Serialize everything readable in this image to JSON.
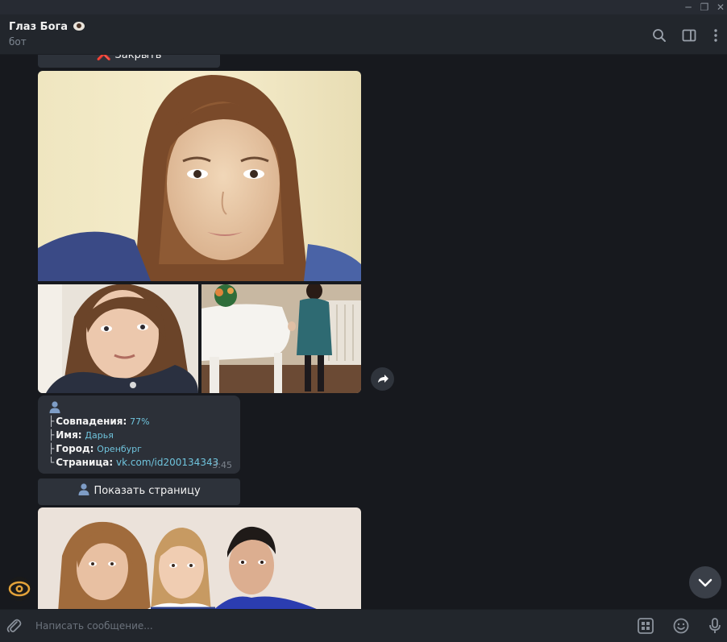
{
  "window": {
    "minimize_glyph": "─",
    "maximize_glyph": "❐",
    "close_glyph": "✕"
  },
  "chat": {
    "title": "Глаз Бога",
    "subtitle": "бот"
  },
  "buttons": {
    "close_icon": "❌",
    "close_label": "Закрыть",
    "show_page_label": "Показать страницу"
  },
  "result": {
    "matches_label": "Совпадения:",
    "matches_value": "77%",
    "name_label": "Имя:",
    "name_value": "Дарья",
    "city_label": "Город:",
    "city_value": "Оренбург",
    "page_label": "Страница:",
    "page_value": "vk.com/id200134343",
    "time": "3:45"
  },
  "composer": {
    "placeholder": "Написать сообщение..."
  },
  "colors": {
    "background": "#17191e",
    "header": "#22262c",
    "bubble": "#2c3038",
    "link": "#6fc3dc",
    "close_x": "#e3473f"
  },
  "icons": [
    "search-icon",
    "sidebar-toggle-icon",
    "more-vertical-icon",
    "share-icon",
    "chevron-down-icon",
    "attach-icon",
    "keyboard-icon",
    "emoji-icon",
    "microphone-icon",
    "person-icon"
  ]
}
